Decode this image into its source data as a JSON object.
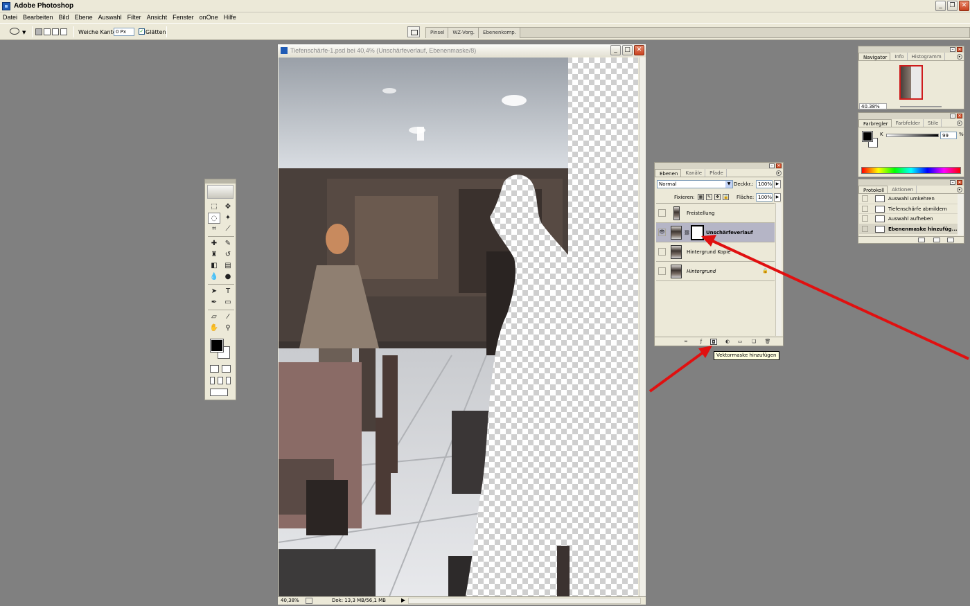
{
  "app": {
    "title": "Adobe Photoshop"
  },
  "menu": [
    "Datei",
    "Bearbeiten",
    "Bild",
    "Ebene",
    "Auswahl",
    "Filter",
    "Ansicht",
    "Fenster",
    "onOne",
    "Hilfe"
  ],
  "options": {
    "feather_label": "Weiche Kante:",
    "feather_value": "0 Px",
    "antialias_label": "Glätten",
    "antialias_checked": true
  },
  "palette_well": [
    "Pinsel",
    "WZ-Vorg.",
    "Ebenenkomp."
  ],
  "document": {
    "title": "Tiefenschärfe-1.psd bei 40,4% (Unschärfeverlauf, Ebenenmaske/8)",
    "zoom": "40,38%",
    "size": "Dok: 13,3 MB/56,1 MB"
  },
  "layers_panel": {
    "tabs": [
      "Ebenen",
      "Kanäle",
      "Pfade"
    ],
    "blend_mode": "Normal",
    "opacity_label": "Deckkr.:",
    "opacity": "100%",
    "lock_label": "Fixieren:",
    "fill_label": "Fläche:",
    "fill": "100%",
    "layers": [
      {
        "name": "Freistellung",
        "visible": false,
        "selected": false,
        "has_mask": false,
        "italic": false,
        "locked": false
      },
      {
        "name": "Unschärfeverlauf",
        "visible": true,
        "selected": true,
        "has_mask": true,
        "italic": false,
        "locked": false
      },
      {
        "name": "Hintergrund Kopie",
        "visible": false,
        "selected": false,
        "has_mask": false,
        "italic": false,
        "locked": false
      },
      {
        "name": "Hintergrund",
        "visible": false,
        "selected": false,
        "has_mask": false,
        "italic": true,
        "locked": true
      }
    ],
    "tooltip": "Vektormaske hinzufügen"
  },
  "navigator": {
    "tabs": [
      "Navigator",
      "Info",
      "Histogramm"
    ],
    "zoom": "40.38%"
  },
  "colors": {
    "tabs": [
      "Farbregler",
      "Farbfelder",
      "Stile"
    ],
    "channel_label": "K",
    "channel_value": "99",
    "unit": "%",
    "k_level": 0.99
  },
  "history": {
    "tabs": [
      "Protokoll",
      "Aktionen"
    ],
    "items": [
      {
        "label": "Auswahl umkehren",
        "selected": false
      },
      {
        "label": "Tiefenschärfe abmildern",
        "selected": false
      },
      {
        "label": "Auswahl aufheben",
        "selected": false
      },
      {
        "label": "Ebenenmaske hinzufüg...",
        "selected": true
      }
    ]
  },
  "colors_accent": {
    "annotation": "#e01010",
    "selection": "#b5b5c6"
  }
}
